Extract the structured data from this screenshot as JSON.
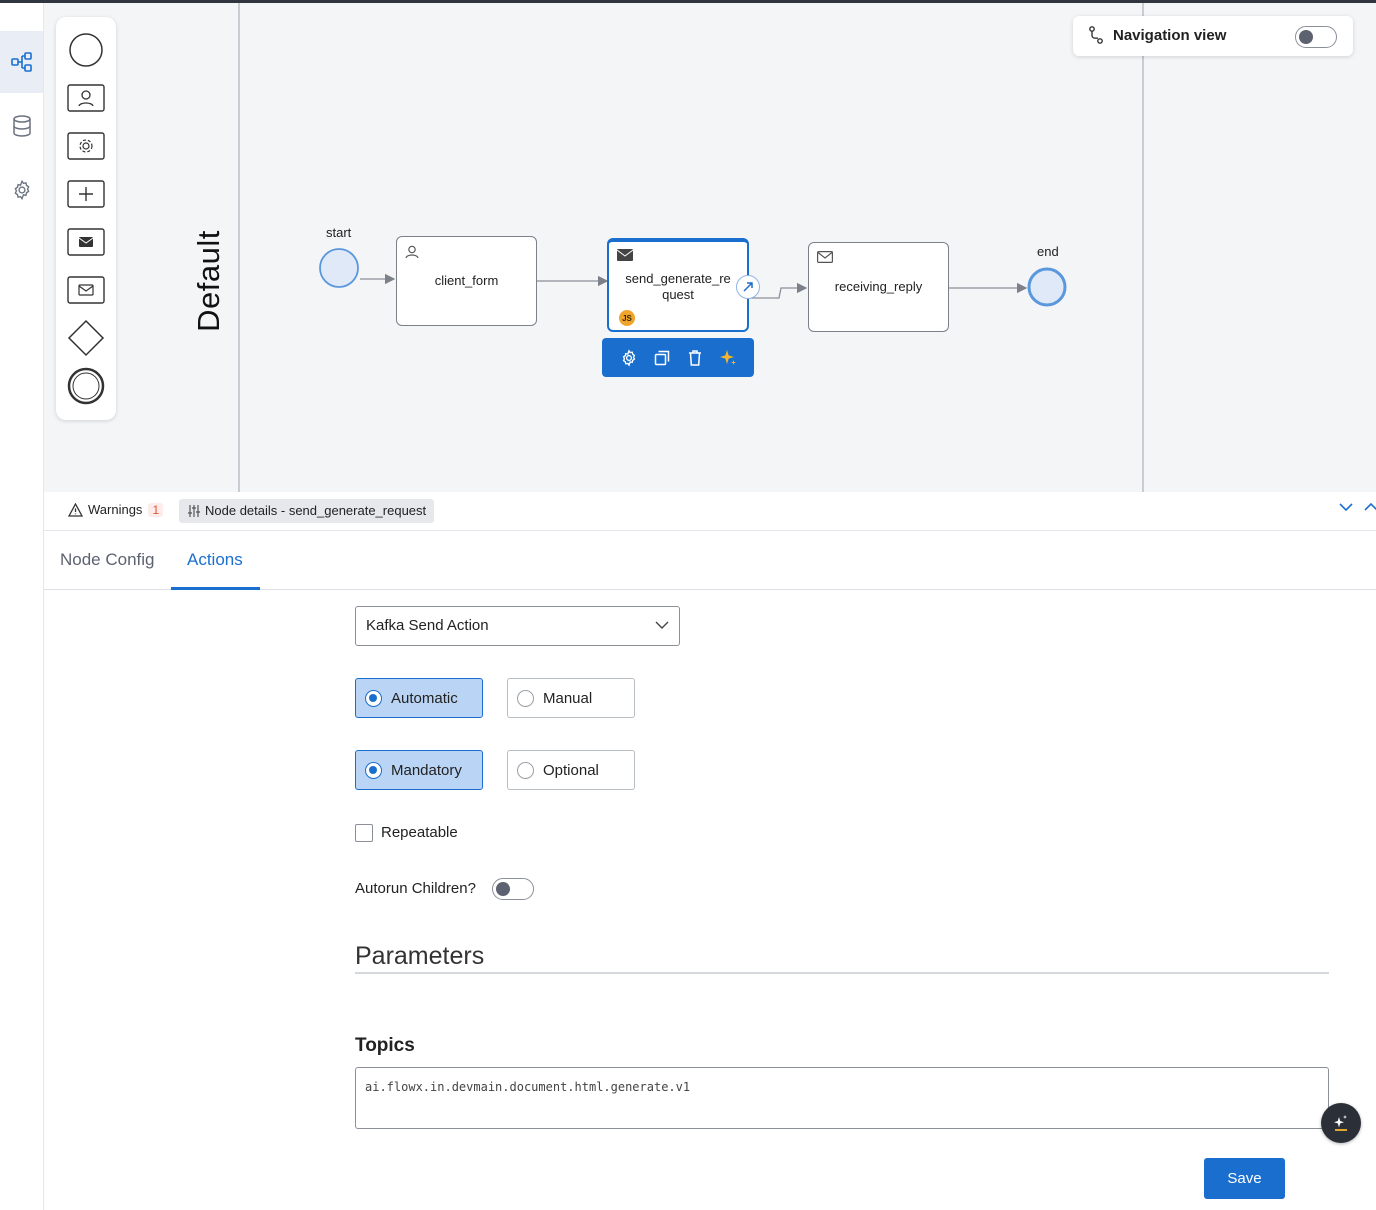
{
  "canvas": {
    "lane_label": "Default",
    "navigation_view": {
      "label": "Navigation view",
      "enabled": false
    },
    "nodes": {
      "start": "start",
      "client_form": "client_form",
      "send_generate_request": "send_generate_re\nquest",
      "receiving_reply": "receiving_reply",
      "end": "end"
    },
    "js_badge": "JS"
  },
  "panel": {
    "warnings_label": "Warnings",
    "warnings_count": "1",
    "node_details": "Node details - send_generate_request",
    "tabs": [
      "Node Config",
      "Actions"
    ],
    "active_tab": "Actions"
  },
  "form": {
    "action_type": "Kafka Send Action",
    "trigger_options": [
      "Automatic",
      "Manual"
    ],
    "trigger_selected": "Automatic",
    "requirement_options": [
      "Mandatory",
      "Optional"
    ],
    "requirement_selected": "Mandatory",
    "repeatable_label": "Repeatable",
    "repeatable": false,
    "autorun_label": "Autorun Children?",
    "autorun": false,
    "parameters_title": "Parameters",
    "topics_label": "Topics",
    "topics_value": "ai.flowx.in.devmain.document.html.generate.v1",
    "save_label": "Save"
  },
  "colors": {
    "accent": "#1a6fce",
    "selected_radio_bg": "#b9d4f4",
    "canvas_bg": "#f4f5f7"
  }
}
